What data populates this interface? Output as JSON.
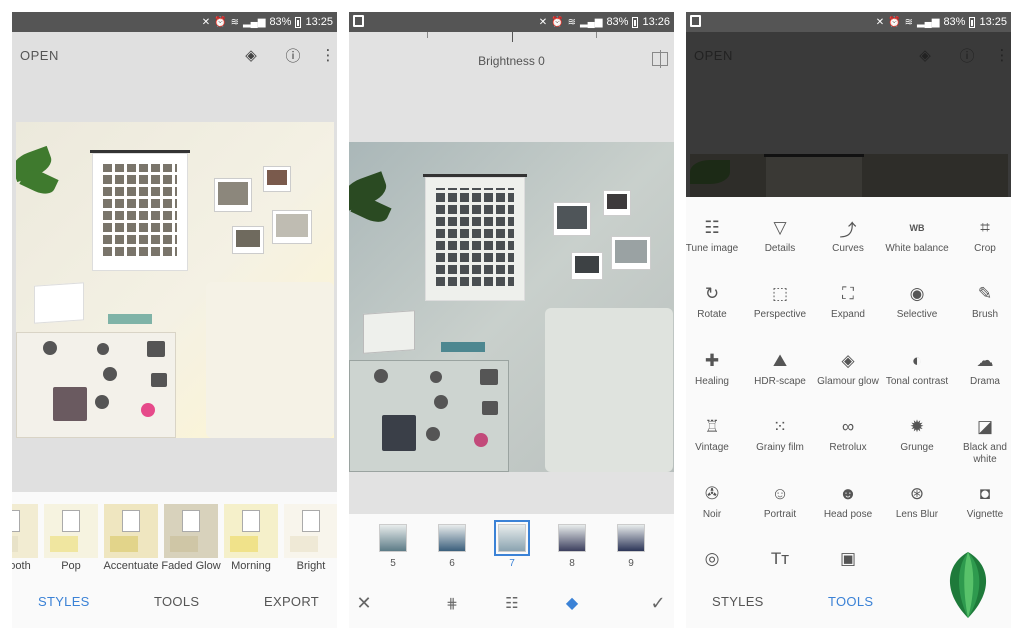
{
  "screens": {
    "left": {
      "status": {
        "battery": "83%",
        "time": "13:25"
      },
      "toolbar": {
        "open_label": "OPEN",
        "icons": [
          "layers-icon",
          "info-icon",
          "more-icon"
        ]
      },
      "styles": [
        {
          "label": "ooth"
        },
        {
          "label": "Pop"
        },
        {
          "label": "Accentuate"
        },
        {
          "label": "Faded Glow"
        },
        {
          "label": "Morning"
        },
        {
          "label": "Bright"
        }
      ],
      "tabs": {
        "styles": "STYLES",
        "tools": "TOOLS",
        "export": "EXPORT"
      }
    },
    "middle": {
      "status": {
        "battery": "83%",
        "time": "13:26"
      },
      "adjust_label": "Brightness 0",
      "filters": [
        {
          "num": "5",
          "color": "#5c7b86"
        },
        {
          "num": "6",
          "color": "#3b5f7c"
        },
        {
          "num": "7",
          "color": "#8aa3b0"
        },
        {
          "num": "8",
          "color": "#3c3f5e"
        },
        {
          "num": "9",
          "color": "#2c3558"
        }
      ],
      "selected_filter": "7",
      "actions": [
        "close-icon",
        "grid-icon",
        "tune-icon",
        "style-icon",
        "check-icon"
      ]
    },
    "right": {
      "status": {
        "battery": "83%",
        "time": "13:25"
      },
      "toolbar": {
        "open_label": "OPEN"
      },
      "tools": [
        {
          "label": "Tune image",
          "icon": "tune-icon",
          "glyph": "☷"
        },
        {
          "label": "Details",
          "icon": "details-icon",
          "glyph": "▽"
        },
        {
          "label": "Curves",
          "icon": "curves-icon",
          "glyph": "⤴"
        },
        {
          "label": "White balance",
          "icon": "white-balance-icon",
          "glyph": "WB"
        },
        {
          "label": "Crop",
          "icon": "crop-icon",
          "glyph": "⌗"
        },
        {
          "label": "Rotate",
          "icon": "rotate-icon",
          "glyph": "↻"
        },
        {
          "label": "Perspective",
          "icon": "perspective-icon",
          "glyph": "⬚"
        },
        {
          "label": "Expand",
          "icon": "expand-icon",
          "glyph": "⛶"
        },
        {
          "label": "Selective",
          "icon": "selective-icon",
          "glyph": "◉"
        },
        {
          "label": "Brush",
          "icon": "brush-icon",
          "glyph": "✎"
        },
        {
          "label": "Healing",
          "icon": "healing-icon",
          "glyph": "✚"
        },
        {
          "label": "HDR-scape",
          "icon": "hdr-icon",
          "glyph": "⛰"
        },
        {
          "label": "Glamour glow",
          "icon": "glamour-glow-icon",
          "glyph": "◈"
        },
        {
          "label": "Tonal contrast",
          "icon": "tonal-contrast-icon",
          "glyph": "◐"
        },
        {
          "label": "Drama",
          "icon": "drama-icon",
          "glyph": "☁"
        },
        {
          "label": "Vintage",
          "icon": "vintage-icon",
          "glyph": "♖"
        },
        {
          "label": "Grainy film",
          "icon": "grainy-film-icon",
          "glyph": "⁙"
        },
        {
          "label": "Retrolux",
          "icon": "retrolux-icon",
          "glyph": "∞"
        },
        {
          "label": "Grunge",
          "icon": "grunge-icon",
          "glyph": "✹"
        },
        {
          "label": "Black and white",
          "icon": "black-and-white-icon",
          "glyph": "◪"
        },
        {
          "label": "Noir",
          "icon": "noir-icon",
          "glyph": "✇"
        },
        {
          "label": "Portrait",
          "icon": "portrait-icon",
          "glyph": "☺"
        },
        {
          "label": "Head pose",
          "icon": "head-pose-icon",
          "glyph": "☻"
        },
        {
          "label": "Lens Blur",
          "icon": "lens-blur-icon",
          "glyph": "⊛"
        },
        {
          "label": "Vignette",
          "icon": "vignette-icon",
          "glyph": "◘"
        },
        {
          "label": "",
          "icon": "double-exposure-icon",
          "glyph": "◎"
        },
        {
          "label": "",
          "icon": "text-icon",
          "glyph": "Tт"
        },
        {
          "label": "",
          "icon": "frames-icon",
          "glyph": "▣"
        }
      ],
      "tabs": {
        "styles": "STYLES",
        "tools": "TOOLS"
      }
    }
  }
}
